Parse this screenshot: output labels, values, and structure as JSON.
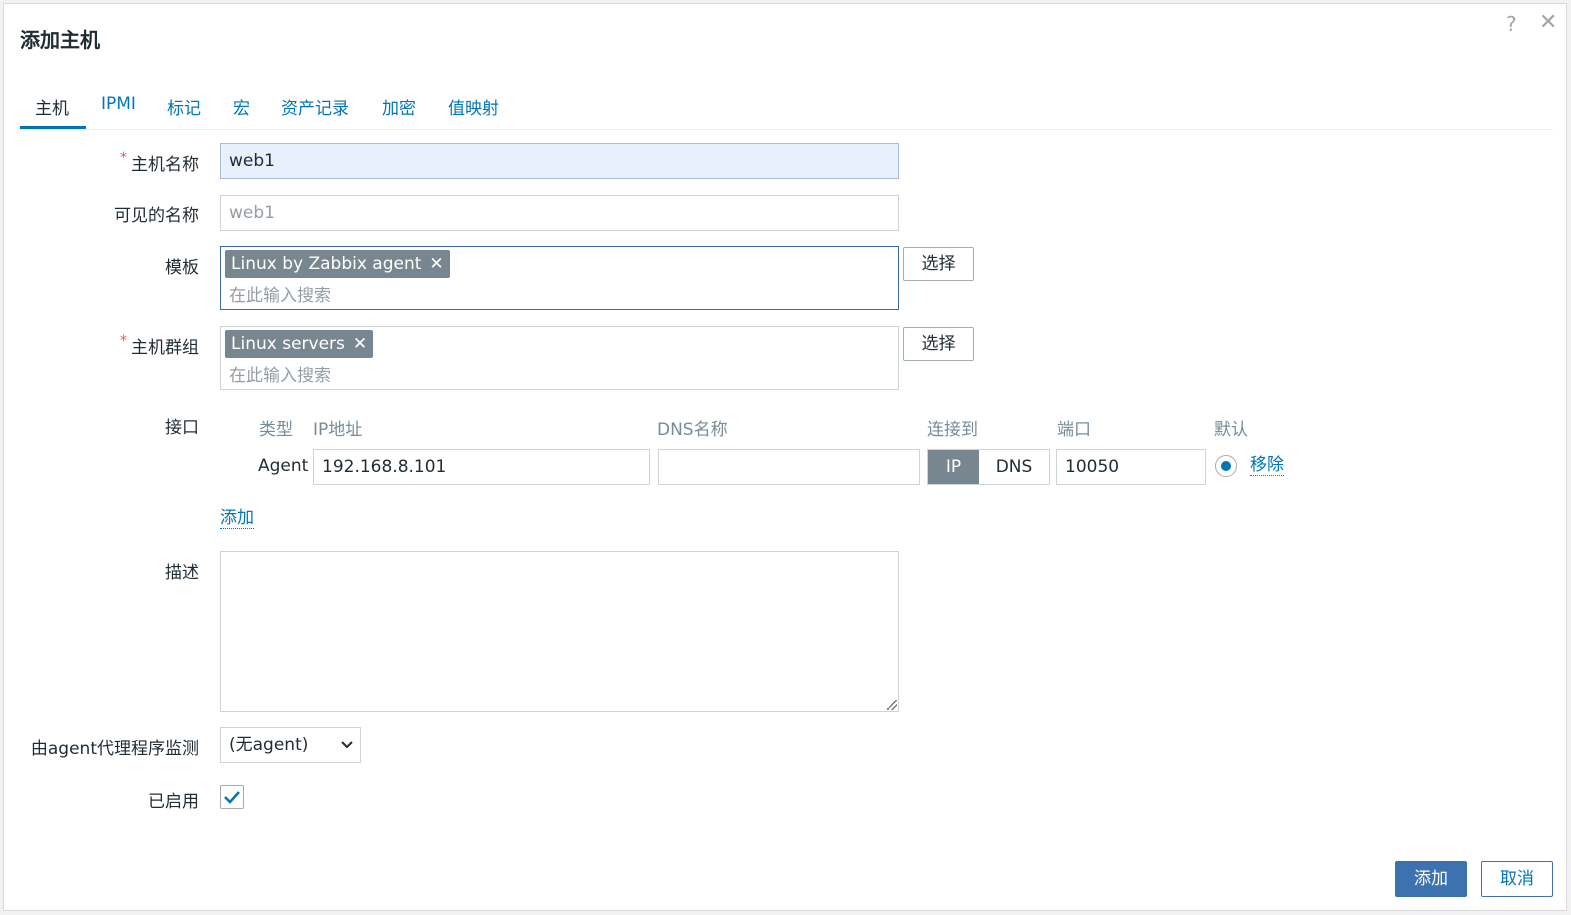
{
  "dialog": {
    "title": "添加主机",
    "help_icon": "question-icon",
    "close_icon": "close-icon"
  },
  "tabs": [
    {
      "label": "主机",
      "active": true
    },
    {
      "label": "IPMI"
    },
    {
      "label": "标记"
    },
    {
      "label": "宏"
    },
    {
      "label": "资产记录"
    },
    {
      "label": "加密"
    },
    {
      "label": "值映射"
    }
  ],
  "form": {
    "host_name": {
      "label": "主机名称",
      "required_mark": "*",
      "value": "web1"
    },
    "visible_name": {
      "label": "可见的名称",
      "placeholder": "web1"
    },
    "templates": {
      "label": "模板",
      "chips": [
        "Linux by Zabbix agent"
      ],
      "search_placeholder": "在此输入搜索",
      "select_label": "选择"
    },
    "host_groups": {
      "label": "主机群组",
      "required_mark": "*",
      "chips": [
        "Linux servers"
      ],
      "search_placeholder": "在此输入搜索",
      "select_label": "选择"
    },
    "interfaces": {
      "label": "接口",
      "headers": {
        "type": "类型",
        "ip": "IP地址",
        "dns": "DNS名称",
        "connect": "连接到",
        "port": "端口",
        "default": "默认"
      },
      "rows": [
        {
          "type": "Agent",
          "ip": "192.168.8.101",
          "dns": "",
          "connect_ip": "IP",
          "connect_dns": "DNS",
          "connect_selected": "IP",
          "port": "10050",
          "default": true,
          "remove": "移除"
        }
      ],
      "add_label": "添加"
    },
    "description": {
      "label": "描述",
      "value": ""
    },
    "monitored_by": {
      "label": "由agent代理程序监测",
      "value": "(无agent)"
    },
    "enabled": {
      "label": "已启用",
      "checked": true
    }
  },
  "footer": {
    "add_label": "添加",
    "cancel_label": "取消"
  },
  "colors": {
    "accent": "#0275b8",
    "primary_button": "#3d72b0",
    "chip": "#78868f",
    "required": "#e45959"
  }
}
